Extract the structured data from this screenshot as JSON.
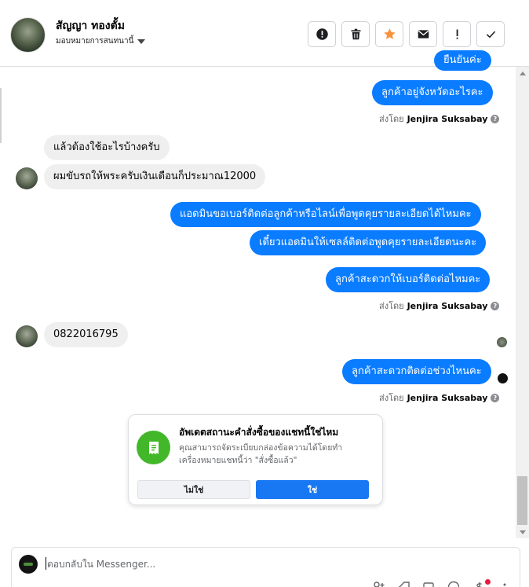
{
  "header": {
    "contact_name": "สัญญา ทองตั้ม",
    "assign_label": "มอบหมายการสนทนานี้"
  },
  "actions": [
    {
      "name": "report-icon",
      "color": "#1c1e21"
    },
    {
      "name": "trash-icon",
      "color": "#1c1e21"
    },
    {
      "name": "star-icon",
      "color": "#f7923a"
    },
    {
      "name": "envelope-icon",
      "color": "#1c1e21"
    },
    {
      "name": "exclamation-icon",
      "color": "#1c1e21"
    },
    {
      "name": "check-icon",
      "color": "#1c1e21"
    }
  ],
  "messages": {
    "m0": "ยืนยันค่ะ",
    "m1": "ลูกค้าอยู่จังหวัดอะไรคะ",
    "m2": "แล้วต้องใช้อะไรบ้างครับ",
    "m3": "ผมขับรถให้พระครับเงินเดือนก็ประมาณ12000",
    "m4": "แอดมินขอเบอร์ติดต่อลูกค้าหรือไลน์เพื่อพูดคุยรายละเอียดได้ไหมคะ",
    "m5": "เดี๋ยวแอดมินให้เซลล์ติดต่อพูดคุยรายละเอียดนะคะ",
    "m6": "ลูกค้าสะดวกให้เบอร์ติดต่อไหมคะ",
    "m7": "0822016795",
    "m8": "ลูกค้าสะดวกติดต่อช่วงไหนคะ"
  },
  "sent_by": {
    "prefix": "ส่งโดย",
    "name": "Jenjira Suksabay"
  },
  "card": {
    "title": "อัพเดตสถานะคำสั่งซื้อของแชทนี้ใช่ไหม",
    "text": "คุณสามารถจัดระเบียบกล่องข้อความได้โดยทำเครื่องหมายแชทนี้ว่า \"สั่งซื้อแล้ว\"",
    "no_label": "ไม่ใช่",
    "yes_label": "ใช่"
  },
  "composer": {
    "placeholder": "ตอบกลับใน Messenger..."
  },
  "colors": {
    "outgoing": "#0a7cff",
    "incoming": "#efefef",
    "primary_button": "#1877f2",
    "card_icon": "#42b72a"
  }
}
